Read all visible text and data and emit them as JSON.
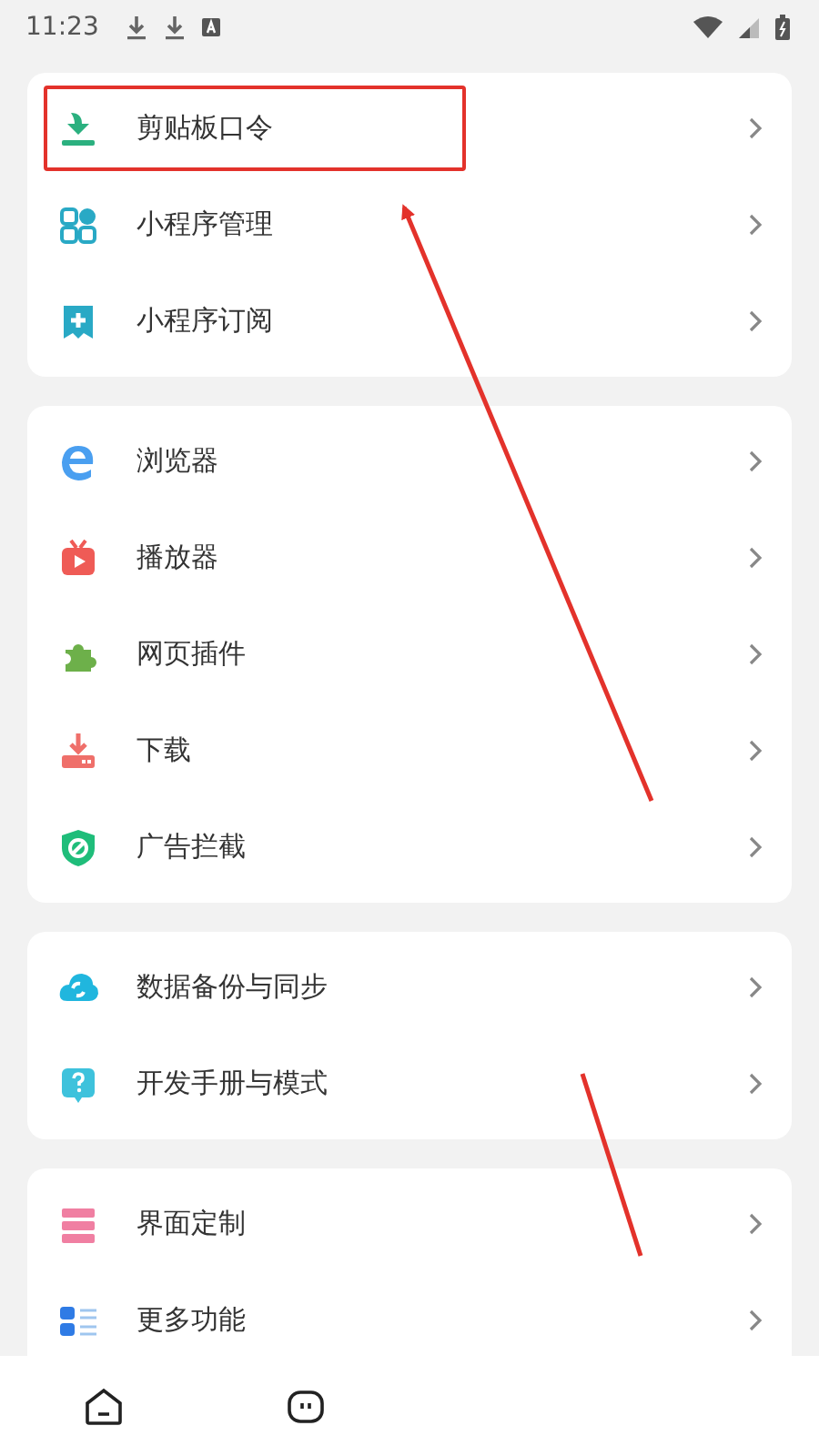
{
  "status_bar": {
    "time": "11:23"
  },
  "groups": [
    {
      "items": [
        {
          "label": "剪贴板口令",
          "highlighted": true
        },
        {
          "label": "小程序管理",
          "highlighted": false
        },
        {
          "label": "小程序订阅",
          "highlighted": false
        }
      ]
    },
    {
      "items": [
        {
          "label": "浏览器",
          "highlighted": false
        },
        {
          "label": "播放器",
          "highlighted": false
        },
        {
          "label": "网页插件",
          "highlighted": false
        },
        {
          "label": "下载",
          "highlighted": false
        },
        {
          "label": "广告拦截",
          "highlighted": false
        }
      ]
    },
    {
      "items": [
        {
          "label": "数据备份与同步",
          "highlighted": false
        },
        {
          "label": "开发手册与模式",
          "highlighted": false
        }
      ]
    },
    {
      "items": [
        {
          "label": "界面定制",
          "highlighted": false
        },
        {
          "label": "更多功能",
          "highlighted": false
        }
      ]
    }
  ]
}
